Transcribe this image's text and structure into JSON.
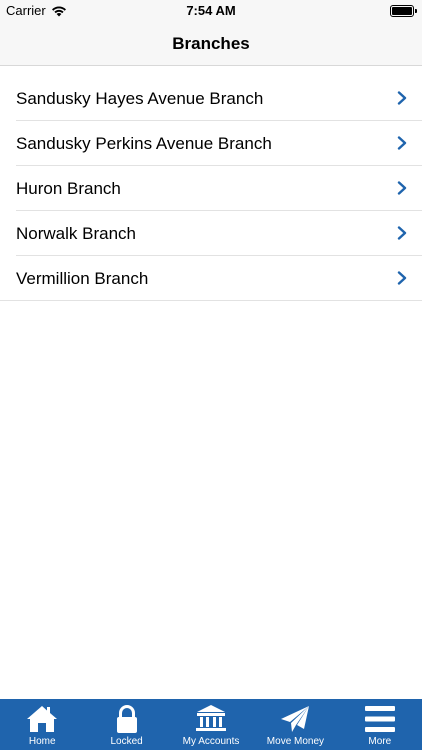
{
  "status_bar": {
    "carrier": "Carrier",
    "time": "7:54 AM"
  },
  "nav": {
    "title": "Branches"
  },
  "branches": [
    {
      "label": "Sandusky Hayes Avenue Branch"
    },
    {
      "label": "Sandusky Perkins Avenue Branch"
    },
    {
      "label": "Huron Branch"
    },
    {
      "label": "Norwalk Branch"
    },
    {
      "label": "Vermillion Branch"
    }
  ],
  "tab_bar": {
    "items": [
      {
        "label": "Home",
        "icon": "home-icon"
      },
      {
        "label": "Locked",
        "icon": "lock-icon"
      },
      {
        "label": "My Accounts",
        "icon": "bank-icon"
      },
      {
        "label": "Move Money",
        "icon": "paper-plane-icon"
      },
      {
        "label": "More",
        "icon": "menu-icon"
      }
    ]
  },
  "colors": {
    "accent": "#1f64ad",
    "chevron": "#1f64ad",
    "tab_bar_background": "#1f64ad",
    "nav_background": "#f7f7f7"
  }
}
